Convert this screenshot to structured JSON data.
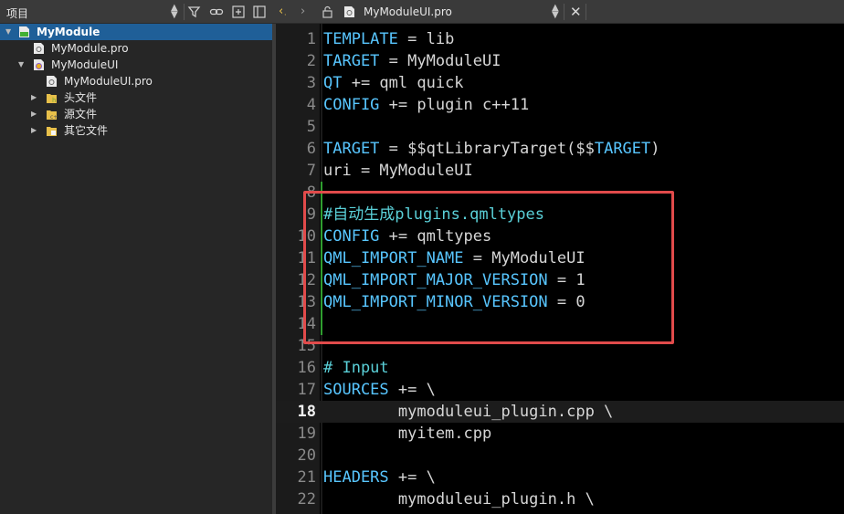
{
  "project_panel": {
    "title": "项目",
    "tree": [
      {
        "label": "MyModule",
        "icon": "qt-project-icon",
        "expanded": true,
        "selected": true
      },
      {
        "label": "MyModule.pro",
        "icon": "pro-file-icon"
      },
      {
        "label": "MyModuleUI",
        "icon": "plugin-project-icon",
        "expanded": true
      },
      {
        "label": "MyModuleUI.pro",
        "icon": "pro-file-icon"
      },
      {
        "label": "头文件",
        "icon": "header-folder-icon",
        "expanded": false
      },
      {
        "label": "源文件",
        "icon": "source-folder-icon",
        "expanded": false
      },
      {
        "label": "其它文件",
        "icon": "other-folder-icon",
        "expanded": false
      }
    ]
  },
  "editor_bar": {
    "file_name": "MyModuleUI.pro"
  },
  "editor": {
    "current_line": 18,
    "lines": [
      {
        "n": "1",
        "text": "TEMPLATE = lib"
      },
      {
        "n": "2",
        "text": "TARGET = MyModuleUI"
      },
      {
        "n": "3",
        "text": "QT += qml quick"
      },
      {
        "n": "4",
        "text": "CONFIG += plugin c++11"
      },
      {
        "n": "5",
        "text": ""
      },
      {
        "n": "6",
        "text": "TARGET = $$qtLibraryTarget($$TARGET)"
      },
      {
        "n": "7",
        "text": "uri = MyModuleUI"
      },
      {
        "n": "8",
        "text": ""
      },
      {
        "n": "9",
        "text": "#自动生成plugins.qmltypes"
      },
      {
        "n": "10",
        "text": "CONFIG += qmltypes"
      },
      {
        "n": "11",
        "text": "QML_IMPORT_NAME = MyModuleUI"
      },
      {
        "n": "12",
        "text": "QML_IMPORT_MAJOR_VERSION = 1"
      },
      {
        "n": "13",
        "text": "QML_IMPORT_MINOR_VERSION = 0"
      },
      {
        "n": "14",
        "text": ""
      },
      {
        "n": "15",
        "text": ""
      },
      {
        "n": "16",
        "text": "# Input"
      },
      {
        "n": "17",
        "text": "SOURCES += \\"
      },
      {
        "n": "18",
        "text": "        mymoduleui_plugin.cpp \\"
      },
      {
        "n": "19",
        "text": "        myitem.cpp"
      },
      {
        "n": "20",
        "text": ""
      },
      {
        "n": "21",
        "text": "HEADERS += \\"
      },
      {
        "n": "22",
        "text": "        mymoduleui_plugin.h \\"
      }
    ]
  },
  "colors": {
    "keyword": "#58c6ff",
    "comment": "#5ad0d8",
    "highlight_box": "#e14b4b",
    "modified_marker": "#2f9e2f",
    "selection": "#1f5f98"
  }
}
